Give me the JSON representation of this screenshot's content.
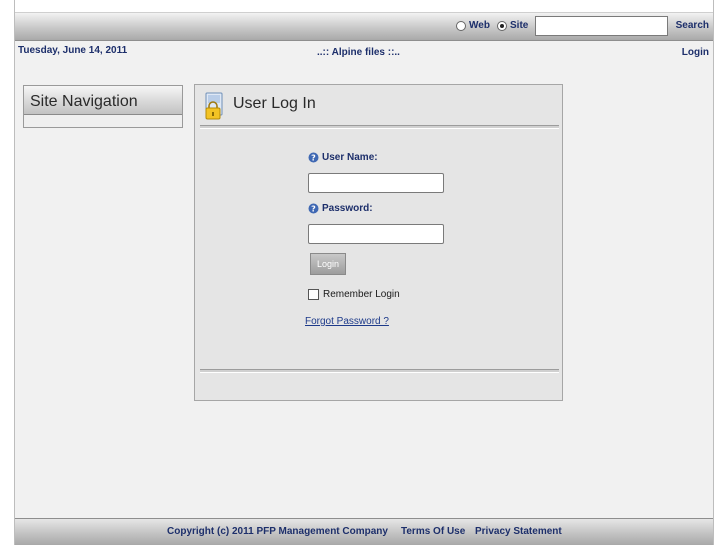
{
  "header": {
    "search_scope_web": "Web",
    "search_scope_site": "Site",
    "search_scope_selected": "Site",
    "search_value": "",
    "search_link": "Search"
  },
  "infobar": {
    "date": "Tuesday, June 14, 2011",
    "site_name": "..:: Alpine files ::..",
    "login_link": "Login"
  },
  "sidebar": {
    "title": "Site Navigation"
  },
  "login_panel": {
    "title": "User Log In",
    "user_name_label": "User Name:",
    "user_name_value": "",
    "password_label": "Password:",
    "password_value": "",
    "login_button": "Login",
    "remember_label": "Remember Login",
    "remember_checked": false,
    "forgot_link": "Forgot Password ?"
  },
  "footer": {
    "copyright": "Copyright (c) 2011 PFP Management Company",
    "terms": "Terms Of Use",
    "privacy": "Privacy Statement"
  },
  "icons": {
    "user_icon": "user-lock-icon",
    "help_icon": "help-icon"
  },
  "colors": {
    "link": "#1d2f6b",
    "panel_bg": "#e5e5e5"
  }
}
